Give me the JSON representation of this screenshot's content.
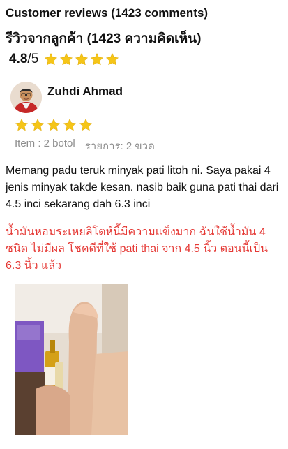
{
  "header": {
    "title_en": "Customer reviews (1423 comments)",
    "title_th": "รีวิวจากลูกค้า (1423 ความคิดเห็น)"
  },
  "rating": {
    "score": "4.8",
    "out_of": "/5",
    "stars": 5,
    "star_color": "#f5c518"
  },
  "review": {
    "reviewer_name": "Zuhdi Ahmad",
    "stars": 5,
    "item_label": "Item : 2 botol",
    "item_label_th": "รายการ: 2 ขวด",
    "text_ms": "Memang padu teruk minyak pati litoh ni. Saya pakai 4 jenis minyak takde kesan. nasib baik guna pati thai dari 4.5 inci sekarang dah 6.3 inci",
    "text_th": "น้ำมันหอมระเหยลิโตห์นี้มีความแข็งมาก ฉันใช้น้ำมัน 4 ชนิด ไม่มีผล โชคดีที่ใช้ pati thai จาก 4.5 นิ้ว ตอนนี้เป็น 6.3 นิ้ว แล้ว",
    "translation_color": "#e53935"
  }
}
